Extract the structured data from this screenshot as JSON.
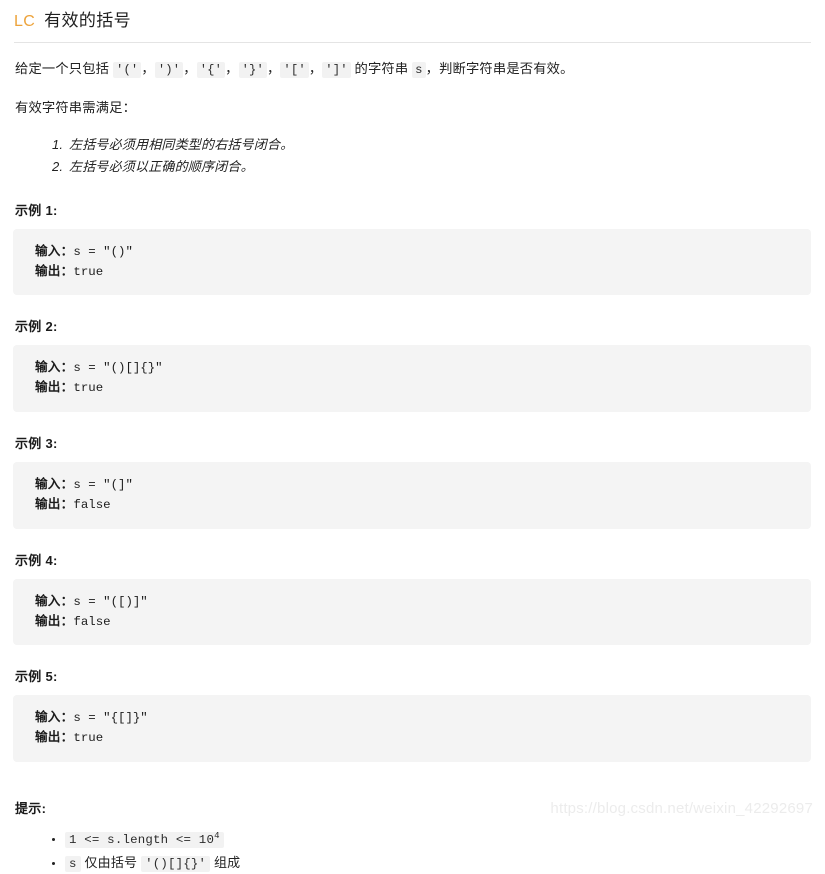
{
  "header": {
    "logo_text": "LC",
    "logo_color": "#eda33b",
    "title": "有效的括号"
  },
  "description": {
    "intro_prefix": "给定一个只包括 ",
    "inline_codes": [
      "'('",
      "')'",
      "'{'",
      "'}'",
      "'['",
      "']'"
    ],
    "sep": "，",
    "mid_text": " 的字符串 ",
    "var_code": "s",
    "intro_suffix": "，判断字符串是否有效。",
    "rules_heading": "有效字符串需满足：",
    "rules": [
      "左括号必须用相同类型的右括号闭合。",
      "左括号必须以正确的顺序闭合。"
    ]
  },
  "examples": [
    {
      "title": "示例 1:",
      "input_label": "输入：",
      "input_value": "s = \"()\"",
      "output_label": "输出：",
      "output_value": "true"
    },
    {
      "title": "示例 2:",
      "input_label": "输入：",
      "input_value": "s = \"()[]{}\"",
      "output_label": "输出：",
      "output_value": "true"
    },
    {
      "title": "示例 3:",
      "input_label": "输入：",
      "input_value": "s = \"(]\"",
      "output_label": "输出：",
      "output_value": "false"
    },
    {
      "title": "示例 4:",
      "input_label": "输入：",
      "input_value": "s = \"([)]\"",
      "output_label": "输出：",
      "output_value": "false"
    },
    {
      "title": "示例 5:",
      "input_label": "输入：",
      "input_value": "s = \"{[]}\"",
      "output_label": "输出：",
      "output_value": "true"
    }
  ],
  "hints": {
    "title": "提示:",
    "items": [
      {
        "code_prefix": "1 <= s.length <= 10",
        "exponent": "4",
        "text_after": ""
      },
      {
        "code_var": "s",
        "text_mid": " 仅由括号 ",
        "code_brackets": "'()[]{}'",
        "text_after": " 组成"
      }
    ]
  },
  "watermark": {
    "text": "https://blog.csdn.net/weixin_42292697"
  }
}
